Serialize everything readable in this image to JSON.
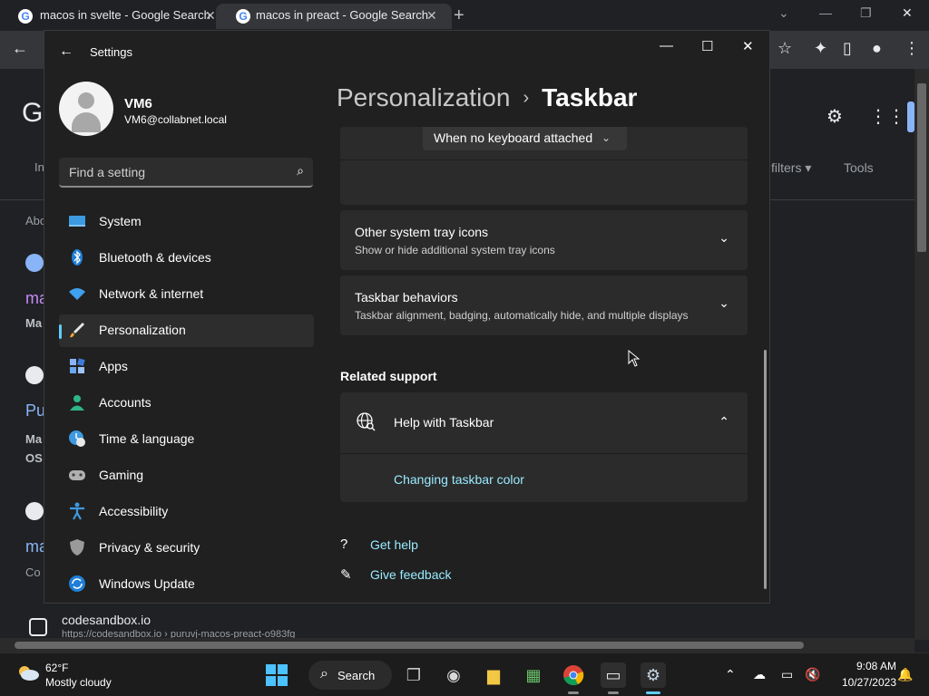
{
  "browser": {
    "tabs": [
      {
        "title": "macos in svelte - Google Search",
        "close": "✕"
      },
      {
        "title": "macos in preact - Google Search",
        "close": "✕"
      }
    ],
    "new_tab": "+",
    "win_controls": {
      "minimize": "—",
      "maximize": "❐",
      "close": "✕"
    },
    "toolbar": {
      "back": "←",
      "star": "☆",
      "puzzle": "✦",
      "panel": "▯",
      "profile": "●",
      "menu": "⋮"
    }
  },
  "page": {
    "logo_fragment": "G",
    "filters_label": "filters ▾",
    "tools_label": "Tools",
    "fragments": {
      "abo": "Abo",
      "ma1": "ma",
      "ma1_sub": "Ma",
      "pu": "Pu",
      "ma2_sub": "Ma",
      "os": "OS",
      "ma3": "ma",
      "co": "Co",
      "in": "In"
    },
    "result": {
      "title": "codesandbox.io",
      "url": "https://codesandbox.io › puruvj-macos-preact-o983fg"
    }
  },
  "settings": {
    "back": "←",
    "title": "Settings",
    "controls": {
      "minimize": "—",
      "maximize": "☐",
      "close": "✕"
    },
    "user": {
      "name": "VM6",
      "email": "VM6@collabnet.local"
    },
    "search": {
      "placeholder": "Find a setting",
      "icon": "⌕"
    },
    "nav": [
      {
        "label": "System",
        "icon": "system-icon"
      },
      {
        "label": "Bluetooth & devices",
        "icon": "bluetooth-icon"
      },
      {
        "label": "Network & internet",
        "icon": "wifi-icon"
      },
      {
        "label": "Personalization",
        "icon": "brush-icon"
      },
      {
        "label": "Apps",
        "icon": "apps-icon"
      },
      {
        "label": "Accounts",
        "icon": "accounts-icon"
      },
      {
        "label": "Time & language",
        "icon": "clock-icon"
      },
      {
        "label": "Gaming",
        "icon": "gamepad-icon"
      },
      {
        "label": "Accessibility",
        "icon": "accessibility-icon"
      },
      {
        "label": "Privacy & security",
        "icon": "shield-icon"
      },
      {
        "label": "Windows Update",
        "icon": "update-icon"
      }
    ],
    "breadcrumb": {
      "parent": "Personalization",
      "separator": "›",
      "current": "Taskbar"
    },
    "dropdown": {
      "value": "When no keyboard attached",
      "chevron": "⌄"
    },
    "cards": [
      {
        "title": "Other system tray icons",
        "subtitle": "Show or hide additional system tray icons",
        "chevron": "⌄"
      },
      {
        "title": "Taskbar behaviors",
        "subtitle": "Taskbar alignment, badging, automatically hide, and multiple displays",
        "chevron": "⌄"
      }
    ],
    "related_support": {
      "heading": "Related support",
      "help_title": "Help with Taskbar",
      "help_chevron": "⌃",
      "link": "Changing taskbar color"
    },
    "footer_links": [
      {
        "label": "Get help",
        "icon": "help-icon"
      },
      {
        "label": "Give feedback",
        "icon": "feedback-icon"
      }
    ]
  },
  "taskbar": {
    "weather": {
      "temp": "62°F",
      "desc": "Mostly cloudy"
    },
    "search_label": "Search",
    "clock": {
      "time": "9:08 AM",
      "date": "10/27/2023"
    },
    "accent": "#60cdff"
  }
}
